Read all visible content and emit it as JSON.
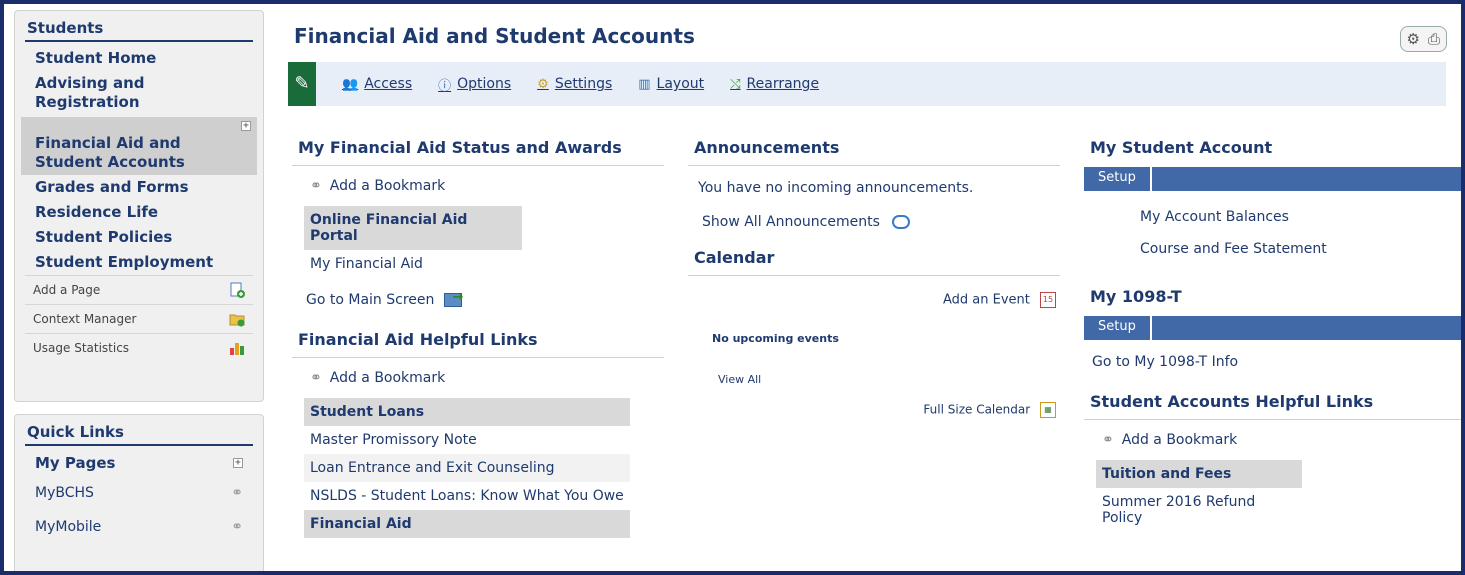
{
  "sidebar": {
    "students_title": "Students",
    "items": [
      {
        "label": "Student Home"
      },
      {
        "label": "Advising and Registration"
      },
      {
        "label": "Financial Aid and Student Accounts"
      },
      {
        "label": "Grades and Forms"
      },
      {
        "label": "Residence Life"
      },
      {
        "label": "Student Policies"
      },
      {
        "label": "Student Employment"
      }
    ],
    "tools": [
      {
        "label": "Add a Page",
        "icon": "add-page-icon"
      },
      {
        "label": "Context Manager",
        "icon": "folder-icon"
      },
      {
        "label": "Usage Statistics",
        "icon": "bar-chart-icon"
      }
    ],
    "quick_links_title": "Quick Links",
    "quick_links": [
      {
        "label": "My Pages"
      },
      {
        "label": "MyBCHS"
      },
      {
        "label": "MyMobile"
      }
    ]
  },
  "header": {
    "title": "Financial Aid and Student Accounts",
    "toolbar": [
      {
        "label": "Access",
        "icon": "users-icon"
      },
      {
        "label": "Options",
        "icon": "options-icon"
      },
      {
        "label": "Settings",
        "icon": "gear-icon"
      },
      {
        "label": "Layout",
        "icon": "layout-icon"
      },
      {
        "label": "Rearrange",
        "icon": "rearrange-icon"
      }
    ]
  },
  "col1": {
    "status_title": "My Financial Aid Status and Awards",
    "add_bookmark": "Add a Bookmark",
    "portal_header": "Online Financial Aid Portal",
    "portal_link": "My Financial Aid",
    "main_screen": "Go to Main Screen",
    "helpful_title": "Financial Aid Helpful Links",
    "add_bookmark2": "Add a Bookmark",
    "loans_header": "Student Loans",
    "loans": [
      {
        "label": "Master Promissory Note"
      },
      {
        "label": "Loan Entrance and Exit Counseling"
      },
      {
        "label": "NSLDS - Student Loans: Know What You Owe"
      }
    ],
    "aid_header": "Financial Aid"
  },
  "col2": {
    "announcements_title": "Announcements",
    "no_announcements": "You have no incoming announcements.",
    "show_all": "Show All Announcements",
    "calendar_title": "Calendar",
    "add_event": "Add an Event",
    "no_events": "No upcoming events",
    "view_all": "View All",
    "full_calendar": "Full Size Calendar"
  },
  "col3": {
    "account_title": "My Student Account",
    "setup1": "Setup",
    "account_links": [
      {
        "label": "My Account Balances"
      },
      {
        "label": "Course and Fee Statement"
      }
    ],
    "t1098_title": "My 1098-T",
    "setup2": "Setup",
    "t1098_link": "Go to My 1098-T Info",
    "helpful_title": "Student Accounts Helpful Links",
    "add_bookmark": "Add a Bookmark",
    "tuition_header": "Tuition and Fees",
    "tuition_link": "Summer 2016 Refund Policy"
  }
}
